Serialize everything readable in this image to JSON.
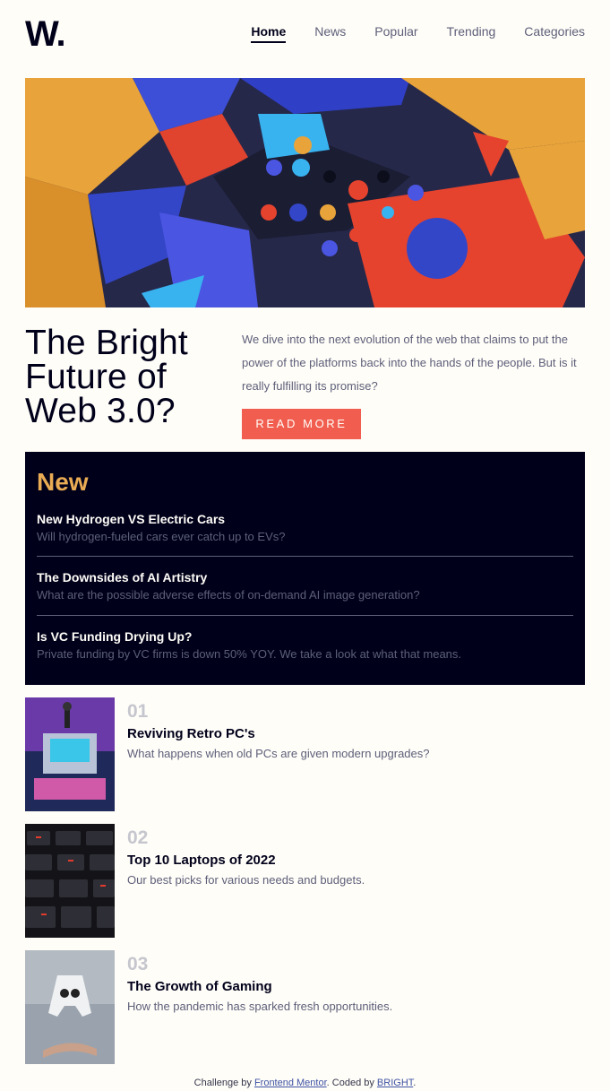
{
  "header": {
    "logo": "W.",
    "nav": [
      {
        "label": "Home",
        "active": true
      },
      {
        "label": "News"
      },
      {
        "label": "Popular"
      },
      {
        "label": "Trending"
      },
      {
        "label": "Categories"
      }
    ]
  },
  "hero": {
    "headline_lines": [
      "The Bright",
      "Future of",
      "Web 3.0?"
    ],
    "description": "We dive into the next evolution of the web that claims to put the power of the platforms back into the hands of the people. But is it really fulfilling its promise?",
    "button": "READ MORE"
  },
  "new_section": {
    "title": "New",
    "items": [
      {
        "title": "New Hydrogen VS Electric Cars",
        "desc": "Will hydrogen-fueled cars ever catch up to EVs?"
      },
      {
        "title": "The Downsides of AI Artistry",
        "desc": "What are the possible adverse effects of on-demand AI image generation?"
      },
      {
        "title": "Is VC Funding Drying Up?",
        "desc": "Private funding by VC firms is down 50% YOY. We take a look at what that means."
      }
    ]
  },
  "trending": [
    {
      "num": "01",
      "title": "Reviving Retro PC's",
      "desc": "What happens when old PCs are given modern upgrades?"
    },
    {
      "num": "02",
      "title": "Top 10 Laptops of 2022",
      "desc": "Our best picks for various needs and budgets."
    },
    {
      "num": "03",
      "title": "The Growth of Gaming",
      "desc": "How the pandemic has sparked fresh opportunities."
    }
  ],
  "footer": {
    "prefix": "Challenge by ",
    "link1": "Frontend Mentor",
    "middle": ". Coded by ",
    "link2": "BRIGHT",
    "suffix": "."
  },
  "colors": {
    "accent_red": "#f15e50",
    "accent_yellow": "#e9ab53",
    "dark": "#00001a",
    "muted": "#5d5f79",
    "background": "#fffdf8"
  }
}
